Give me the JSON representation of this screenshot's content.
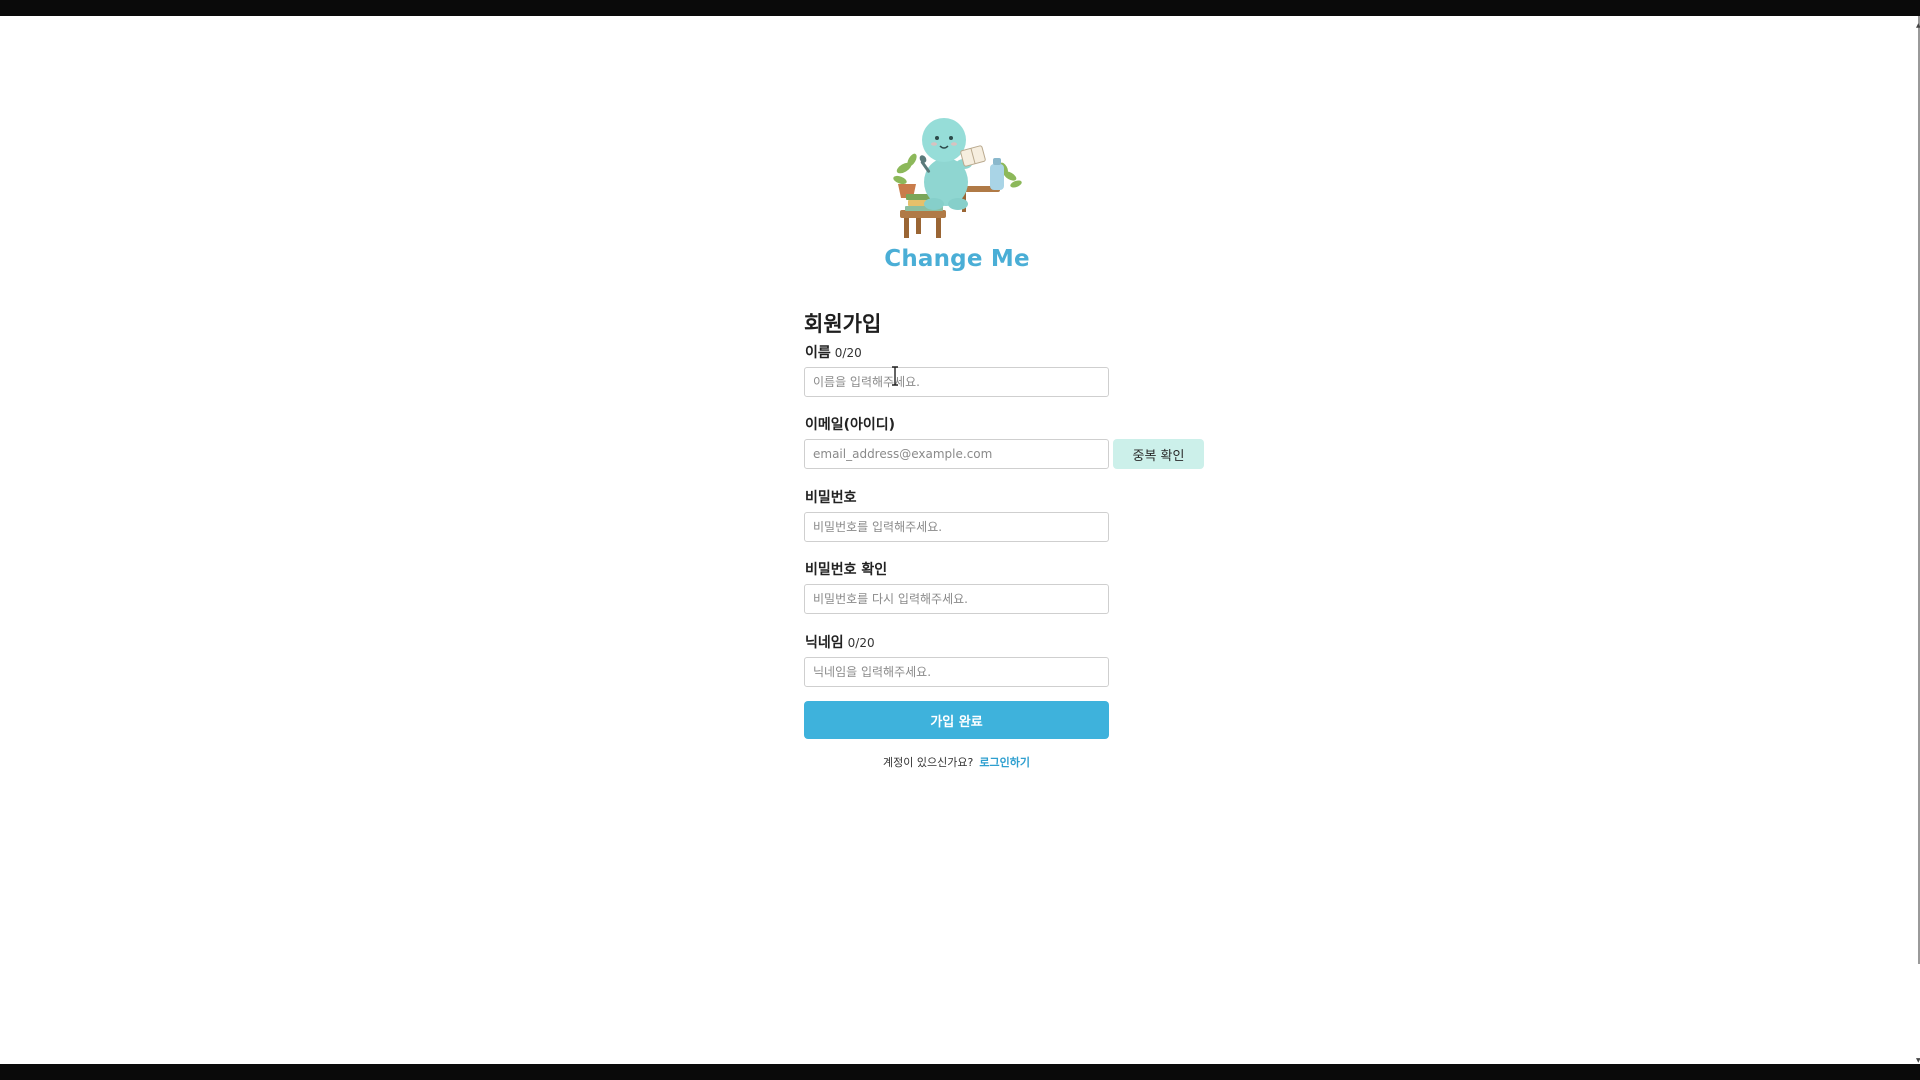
{
  "brand": {
    "name": "Change Me"
  },
  "form": {
    "title": "회원가입",
    "fields": {
      "name": {
        "label": "이름",
        "counter": "0/20",
        "placeholder": "이름을 입력해주세요.",
        "value": ""
      },
      "email": {
        "label": "이메일(아이디)",
        "placeholder": "email_address@example.com",
        "value": "",
        "check_button": "중복 확인"
      },
      "password": {
        "label": "비밀번호",
        "placeholder": "비밀번호를 입력해주세요.",
        "value": ""
      },
      "password_confirm": {
        "label": "비밀번호 확인",
        "placeholder": "비밀번호를 다시 입력해주세요.",
        "value": ""
      },
      "nickname": {
        "label": "닉네임",
        "counter": "0/20",
        "placeholder": "닉네임을 입력해주세요.",
        "value": ""
      }
    },
    "submit_label": "가입 완료",
    "login_prompt": "계정이 있으신가요?",
    "login_link": "로그인하기"
  },
  "colors": {
    "brand": "#4aaed6",
    "primary_button": "#3eb2dc",
    "secondary_button": "#ccf0ea",
    "link": "#2e9fcf"
  },
  "icons": {
    "mascot": "reading-mascot-illustration",
    "cursor": "text-cursor-icon"
  }
}
